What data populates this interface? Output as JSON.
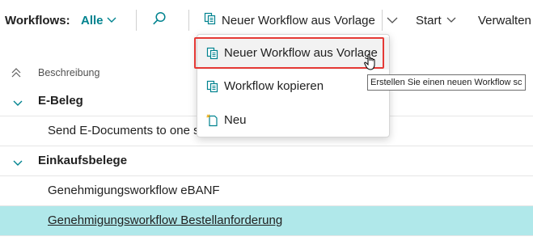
{
  "toolbar": {
    "workflows_label": "Workflows:",
    "filter_value": "Alle",
    "new_from_template_label": "Neuer Workflow aus Vorlage",
    "start_label": "Start",
    "manage_label": "Verwalten"
  },
  "list": {
    "column_header": "Beschreibung",
    "groups": [
      {
        "label": "E-Beleg",
        "items": [
          "Send E-Documents to one s"
        ]
      },
      {
        "label": "Einkaufsbelege",
        "items": [
          "Genehmigungsworkflow eBANF",
          "Genehmigungsworkflow Bestellanforderung"
        ]
      }
    ]
  },
  "menu": {
    "items": [
      {
        "label": "Neuer Workflow aus Vorlage",
        "icon": "copy-document-icon"
      },
      {
        "label": "Workflow kopieren",
        "icon": "copy-document-icon"
      },
      {
        "label": "Neu",
        "icon": "new-document-icon"
      }
    ]
  },
  "tooltip": "Erstellen Sie einen neuen Workflow sc",
  "colors": {
    "accent": "#00838f",
    "selected_row": "#b0e8ea",
    "focus_border": "#e53935"
  }
}
